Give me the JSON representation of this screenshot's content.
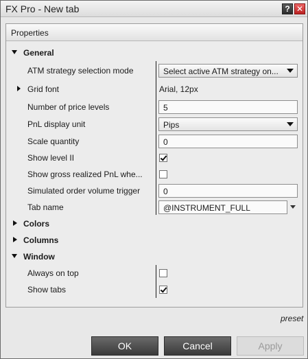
{
  "window": {
    "title": "FX Pro - New tab",
    "help_glyph": "?",
    "close_glyph": "✕"
  },
  "panel": {
    "header": "Properties"
  },
  "general": {
    "label": "General",
    "rows": {
      "atm_mode": {
        "label": "ATM strategy selection mode",
        "value": "Select active ATM strategy on..."
      },
      "grid_font": {
        "label": "Grid font",
        "value": "Arial, 12px"
      },
      "price_levels": {
        "label": "Number of price levels",
        "value": "5"
      },
      "pnl_unit": {
        "label": "PnL display unit",
        "value": "Pips"
      },
      "scale_qty": {
        "label": "Scale quantity",
        "value": "0"
      },
      "show_level2": {
        "label": "Show level II",
        "checked": true
      },
      "show_gross": {
        "label": "Show gross realized PnL whe...",
        "checked": false
      },
      "sim_trigger": {
        "label": "Simulated order volume trigger",
        "value": "0"
      },
      "tab_name": {
        "label": "Tab name",
        "value": "@INSTRUMENT_FULL"
      }
    }
  },
  "colors": {
    "label": "Colors"
  },
  "columns": {
    "label": "Columns"
  },
  "window_cat": {
    "label": "Window",
    "rows": {
      "always_on_top": {
        "label": "Always on top",
        "checked": false
      },
      "show_tabs": {
        "label": "Show tabs",
        "checked": true
      }
    }
  },
  "footer": {
    "preset": "preset",
    "ok": "OK",
    "cancel": "Cancel",
    "apply": "Apply"
  },
  "icons": {
    "expanded": "triangle-down-icon",
    "collapsed": "triangle-right-icon"
  }
}
